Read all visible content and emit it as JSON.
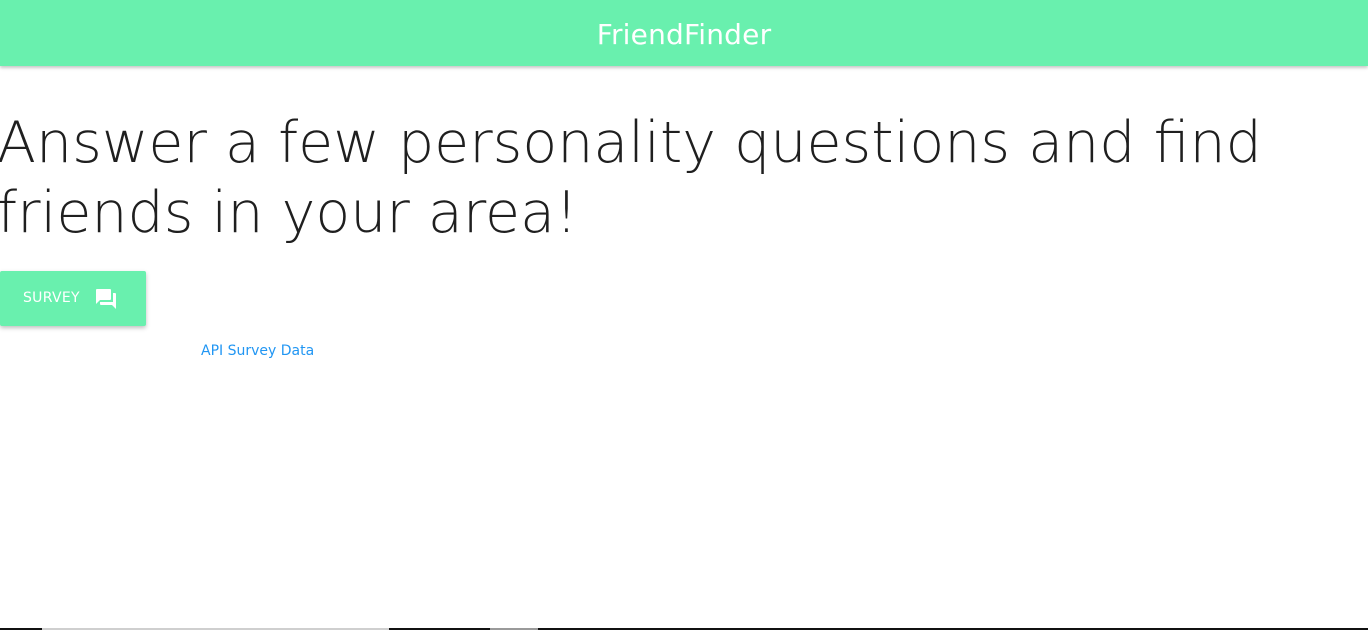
{
  "navbar": {
    "brand": "FriendFinder"
  },
  "main": {
    "headline": "Answer a few personality questions and find friends in your area!",
    "survey_button": {
      "label": "SURVEY",
      "icon": "forum-icon"
    },
    "api_link": "API Survey Data"
  },
  "colors": {
    "accent": "#69f0ae",
    "link": "#2196f3",
    "headline": "#1f1f1f"
  }
}
